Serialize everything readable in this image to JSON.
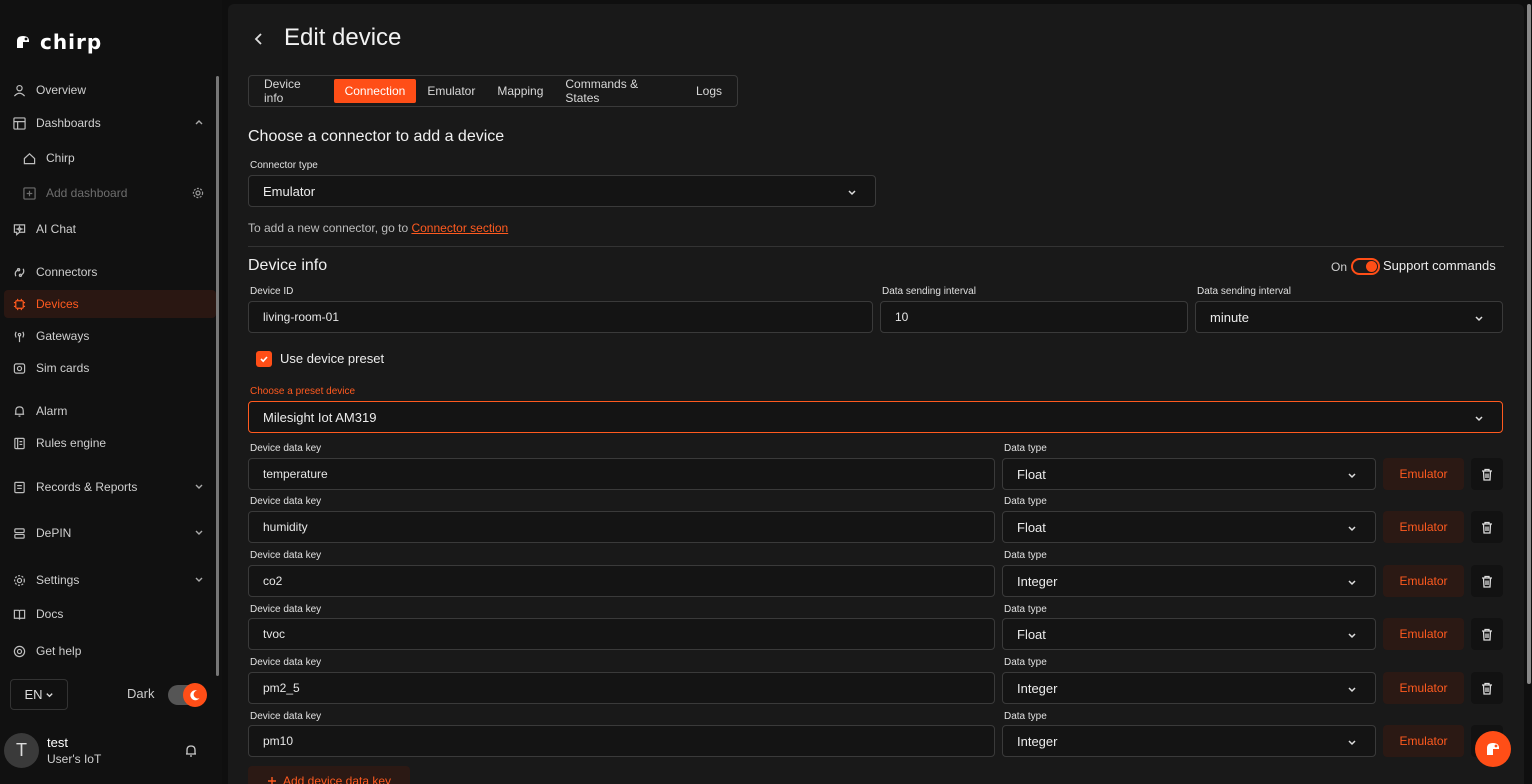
{
  "brand": {
    "name": "chirp"
  },
  "sidebar": {
    "items": [
      {
        "label": "Overview",
        "icon": "user-icon"
      },
      {
        "label": "Dashboards",
        "icon": "layout-icon"
      },
      {
        "label": "Chirp",
        "icon": "home-icon"
      },
      {
        "label": "Add dashboard",
        "icon": "plus-square-icon"
      },
      {
        "label": "AI Chat",
        "icon": "ai-chat-icon"
      },
      {
        "label": "Connectors",
        "icon": "connector-icon"
      },
      {
        "label": "Devices",
        "icon": "chip-icon"
      },
      {
        "label": "Gateways",
        "icon": "antenna-icon"
      },
      {
        "label": "Sim cards",
        "icon": "sim-icon"
      },
      {
        "label": "Alarm",
        "icon": "bell-icon"
      },
      {
        "label": "Rules engine",
        "icon": "book-icon"
      },
      {
        "label": "Records & Reports",
        "icon": "report-icon"
      },
      {
        "label": "DePIN",
        "icon": "stack-icon"
      },
      {
        "label": "Settings",
        "icon": "gear-icon"
      },
      {
        "label": "Docs",
        "icon": "docs-icon"
      },
      {
        "label": "Get help",
        "icon": "help-icon"
      }
    ],
    "language": "EN",
    "theme_label": "Dark",
    "user": {
      "initial": "T",
      "name": "test",
      "org": "User's IoT"
    }
  },
  "page": {
    "title": "Edit device",
    "tabs": [
      "Device info",
      "Connection",
      "Emulator",
      "Mapping",
      "Commands & States",
      "Logs"
    ],
    "active_tab": "Connection"
  },
  "connector": {
    "heading": "Choose a connector to add a device",
    "type_label": "Connector type",
    "type_value": "Emulator",
    "hint_text": "To add a new connector, go to ",
    "hint_link": "Connector section"
  },
  "device_info": {
    "heading": "Device info",
    "support_on": "On",
    "support_label": "Support commands",
    "id_label": "Device ID",
    "id_value": "living-room-01",
    "interval_label": "Data sending interval",
    "interval_value": "10",
    "interval_unit_label": "Data sending interval",
    "interval_unit_value": "minute",
    "use_preset_label": "Use device preset",
    "preset_label": "Choose a preset device",
    "preset_value": "Milesight Iot AM319"
  },
  "data_keys": {
    "key_label": "Device data key",
    "type_label": "Data type",
    "emulator_label": "Emulator",
    "rows": [
      {
        "key": "temperature",
        "type": "Float"
      },
      {
        "key": "humidity",
        "type": "Float"
      },
      {
        "key": "co2",
        "type": "Integer"
      },
      {
        "key": "tvoc",
        "type": "Float"
      },
      {
        "key": "pm2_5",
        "type": "Integer"
      },
      {
        "key": "pm10",
        "type": "Integer"
      }
    ],
    "add_label": "Add device data key"
  },
  "colors": {
    "accent": "#ff4e17",
    "background": "#191919",
    "sidebar": "#111111"
  }
}
